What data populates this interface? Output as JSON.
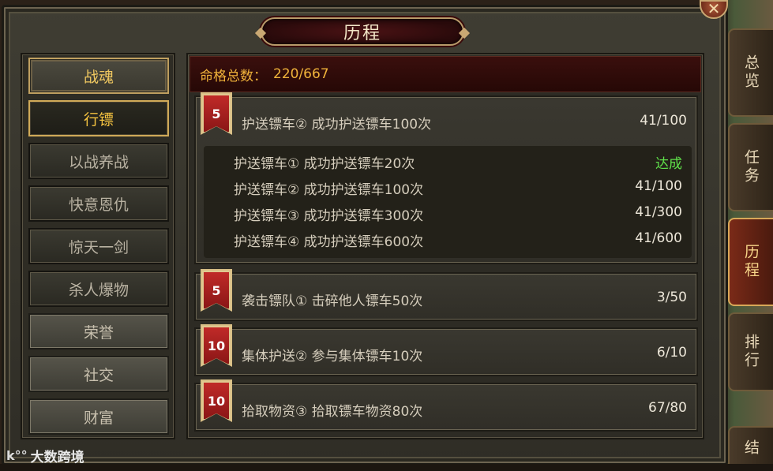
{
  "window": {
    "title": "历程",
    "close_symbol": "✕"
  },
  "sidebar": {
    "items": [
      {
        "label": "战魂",
        "style": "gold"
      },
      {
        "label": "行镖",
        "style": "active"
      },
      {
        "label": "以战养战",
        "style": "dark"
      },
      {
        "label": "快意恩仇",
        "style": "dark"
      },
      {
        "label": "惊天一剑",
        "style": "dark"
      },
      {
        "label": "杀人爆物",
        "style": "dark"
      },
      {
        "label": "荣誉",
        "style": "stone"
      },
      {
        "label": "社交",
        "style": "stone"
      },
      {
        "label": "财富",
        "style": "stone"
      }
    ]
  },
  "summary": {
    "label": "命格总数：",
    "value": "220/667"
  },
  "achievements": [
    {
      "points": "5",
      "title": "护送镖车② 成功护送镖车100次",
      "progress": "41/100",
      "expanded": true,
      "stages": [
        {
          "name": "护送镖车① 成功护送镖车20次",
          "value": "达成",
          "done": true
        },
        {
          "name": "护送镖车② 成功护送镖车100次",
          "value": "41/100",
          "done": false
        },
        {
          "name": "护送镖车③ 成功护送镖车300次",
          "value": "41/300",
          "done": false
        },
        {
          "name": "护送镖车④ 成功护送镖车600次",
          "value": "41/600",
          "done": false
        }
      ]
    },
    {
      "points": "5",
      "title": "袭击镖队① 击碎他人镖车50次",
      "progress": "3/50",
      "expanded": false
    },
    {
      "points": "10",
      "title": "集体护送② 参与集体镖车10次",
      "progress": "6/10",
      "expanded": false
    },
    {
      "points": "10",
      "title": "拾取物资③ 拾取镖车物资80次",
      "progress": "67/80",
      "expanded": false
    }
  ],
  "right_tabs": [
    {
      "label": "总览",
      "active": false
    },
    {
      "label": "任务",
      "active": false
    },
    {
      "label": "历程",
      "active": true
    },
    {
      "label": "排行",
      "active": false
    },
    {
      "label": "结",
      "active": false
    }
  ],
  "watermark": {
    "icon": "k°°",
    "text": "大数跨境"
  },
  "colors": {
    "accent_gold": "#f0b23a",
    "done_green": "#5fe04a",
    "badge_red": "#c02a28"
  }
}
